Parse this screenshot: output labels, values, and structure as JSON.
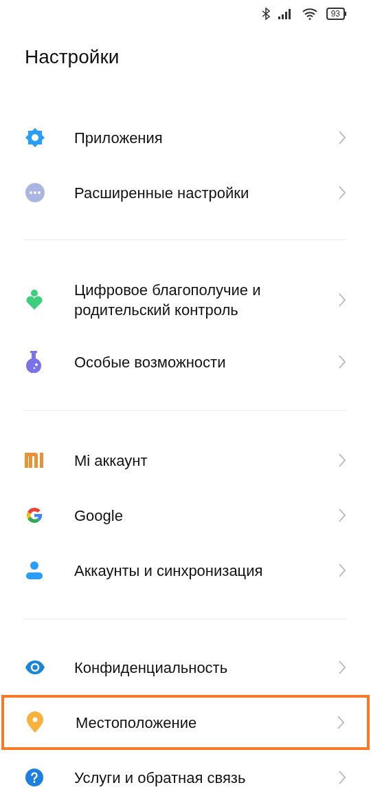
{
  "status_bar": {
    "battery": "93"
  },
  "header": {
    "title": "Настройки"
  },
  "sections": [
    {
      "items": [
        {
          "label": "Приложения",
          "highlighted": false
        },
        {
          "label": "Расширенные настройки",
          "highlighted": false
        }
      ]
    },
    {
      "items": [
        {
          "label": "Цифровое благополучие и родительский контроль",
          "highlighted": false
        },
        {
          "label": "Особые возможности",
          "highlighted": false
        }
      ]
    },
    {
      "items": [
        {
          "label": "Mi аккаунт",
          "highlighted": false
        },
        {
          "label": "Google",
          "highlighted": false
        },
        {
          "label": "Аккаунты и синхронизация",
          "highlighted": false
        }
      ]
    },
    {
      "items": [
        {
          "label": "Конфиденциальность",
          "highlighted": false
        },
        {
          "label": "Местоположение",
          "highlighted": true
        },
        {
          "label": "Услуги и обратная связь",
          "highlighted": false
        }
      ]
    }
  ]
}
